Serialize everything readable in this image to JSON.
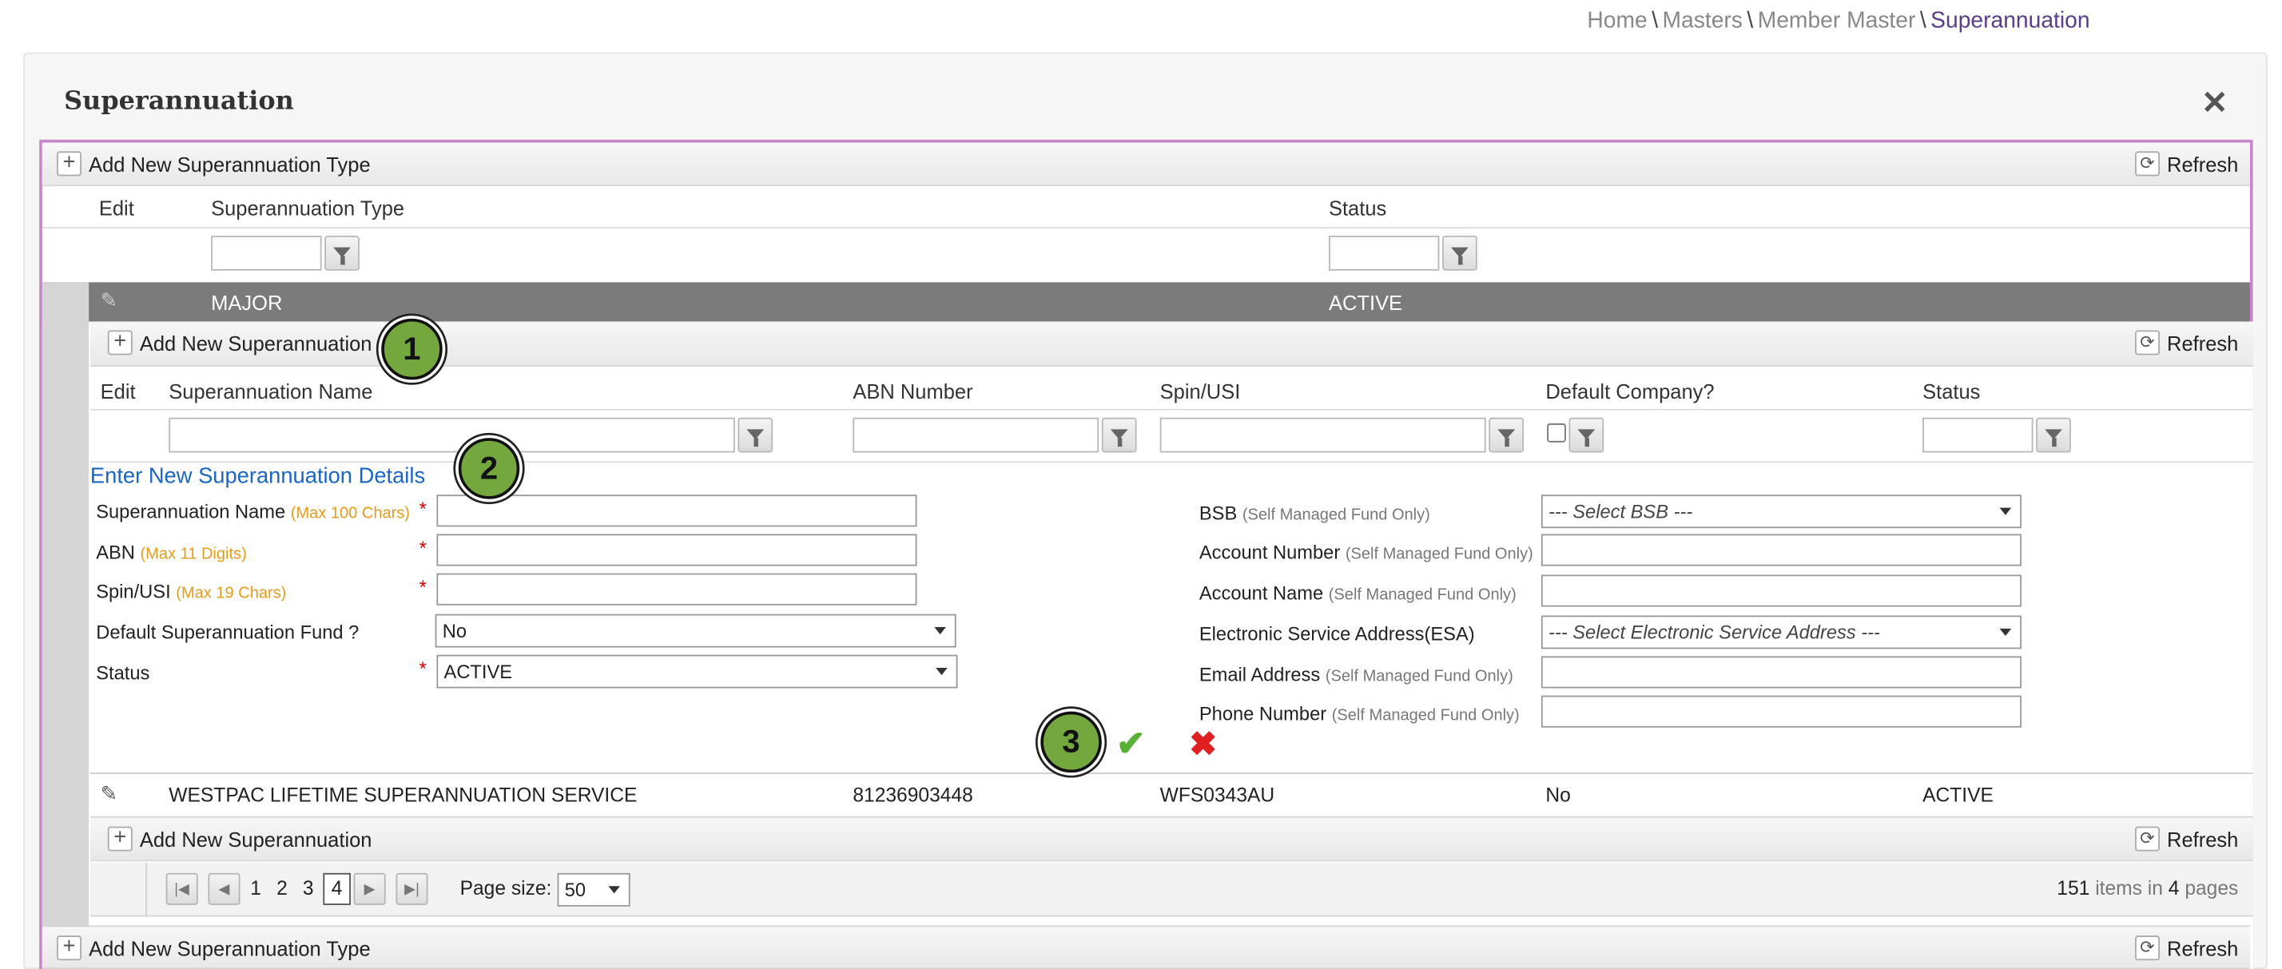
{
  "breadcrumb": {
    "items": [
      "Home",
      "Masters",
      "Member Master"
    ],
    "separator": "\\",
    "current": "Superannuation"
  },
  "panel": {
    "title": "Superannuation",
    "close_glyph": "✕"
  },
  "outer_grid": {
    "add_button": "Add New Superannuation Type",
    "refresh_button": "Refresh",
    "columns": [
      "Edit",
      "Superannuation Type",
      "Status"
    ],
    "row": {
      "type": "MAJOR",
      "status": "ACTIVE"
    }
  },
  "inner_grid": {
    "add_button": "Add New Superannuation",
    "refresh_button": "Refresh",
    "columns": [
      "Edit",
      "Superannuation Name",
      "ABN Number",
      "Spin/USI",
      "Default Company?",
      "Status"
    ]
  },
  "form": {
    "title": "Enter New Superannuation Details",
    "fields_left": [
      {
        "label": "Superannuation Name",
        "hint": "(Max 100 Chars)",
        "required": "*"
      },
      {
        "label": "ABN",
        "hint": "(Max 11 Digits)",
        "required": "*"
      },
      {
        "label": "Spin/USI",
        "hint": "(Max 19 Chars)",
        "required": "*"
      },
      {
        "label": "Default Superannuation Fund ?",
        "value": "No"
      },
      {
        "label": "Status",
        "required": "*",
        "value": "ACTIVE"
      }
    ],
    "fields_right": [
      {
        "label": "BSB",
        "hint": "(Self Managed Fund Only)",
        "placeholder": "--- Select BSB ---"
      },
      {
        "label": "Account Number",
        "hint": "(Self Managed Fund Only)"
      },
      {
        "label": "Account Name",
        "hint": "(Self Managed Fund Only)"
      },
      {
        "label": "Electronic Service Address(ESA)",
        "placeholder": "--- Select Electronic Service Address ---"
      },
      {
        "label": "Email Address",
        "hint": "(Self Managed Fund Only)"
      },
      {
        "label": "Phone Number",
        "hint": "(Self Managed Fund Only)"
      }
    ]
  },
  "rows": [
    {
      "name": "WESTPAC LIFETIME SUPERANNUATION SERVICE",
      "abn": "81236903448",
      "spin": "WFS0343AU",
      "default_company": "No",
      "status": "ACTIVE"
    }
  ],
  "pager": {
    "pages": [
      "1",
      "2",
      "3",
      "4"
    ],
    "current_page": "4",
    "page_size_label": "Page size:",
    "page_size": "50",
    "summary_count": "151",
    "summary_mid": "items in",
    "summary_pages": "4",
    "summary_end": "pages"
  },
  "badges": [
    "1",
    "2",
    "3"
  ],
  "colors": {
    "accent_border": "#c985c9",
    "badge_fill": "#74a83e",
    "link_blue": "#1a66c4",
    "major_row": "#7b7b7b"
  }
}
